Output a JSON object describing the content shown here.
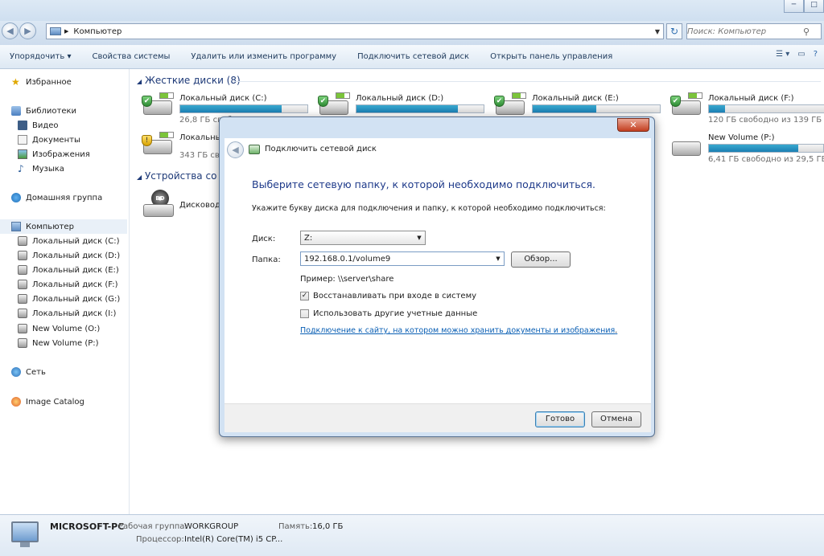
{
  "window": {
    "minimize": "─",
    "maximize": "□"
  },
  "address": {
    "path": "Компьютер",
    "search_placeholder": "Поиск: Компьютер",
    "back": "◀",
    "forward": "▶",
    "refresh": "↻"
  },
  "toolbar": {
    "items": [
      "Упорядочить ▾",
      "Свойства системы",
      "Удалить или изменить программу",
      "Подключить сетевой диск",
      "Открыть панель управления"
    ]
  },
  "sidebar": {
    "favorites": "Избранное",
    "libraries": "Библиотеки",
    "lib_items": [
      "Видео",
      "Документы",
      "Изображения",
      "Музыка"
    ],
    "homegroup": "Домашняя группа",
    "computer": "Компьютер",
    "drives": [
      "Локальный диск (C:)",
      "Локальный диск (D:)",
      "Локальный диск (E:)",
      "Локальный диск (F:)",
      "Локальный диск (G:)",
      "Локальный диск (I:)",
      "New Volume (O:)",
      "New Volume (P:)"
    ],
    "network": "Сеть",
    "image_catalog": "Image Catalog"
  },
  "content": {
    "hdd_header": "Жесткие диски (8)",
    "devices_header": "Устройства со с",
    "disks": [
      {
        "name": "Локальный диск (C:)",
        "free": "26,8 ГБ своб",
        "fill": 0.8
      },
      {
        "name": "Локальный диск (D:)",
        "free": "",
        "fill": 0.8
      },
      {
        "name": "Локальный диск (E:)",
        "free": "",
        "fill": 0.5
      },
      {
        "name": "Локальный диск (F:)",
        "free": "120 ГБ свободно из 139 ГБ",
        "fill": 0.14
      },
      {
        "name": "Локальный",
        "free": "343 ГБ своб",
        "fill": 0.0
      },
      {
        "name": "New Volume (P:)",
        "free": "6,41 ГБ свободно из 29,5 ГБ",
        "fill": 0.78
      }
    ],
    "bd_drive": "Дисковод"
  },
  "status": {
    "pc_name": "MICROSOFT-PC",
    "workgroup_label": "Рабочая группа:",
    "workgroup": "WORKGROUP",
    "memory_label": "Память:",
    "memory": "16,0 ГБ",
    "cpu_label": "Процессор:",
    "cpu": "Intel(R) Core(TM) i5 CP..."
  },
  "dialog": {
    "close": "✕",
    "title": "Подключить сетевой диск",
    "heading": "Выберите сетевую папку, к которой необходимо подключиться.",
    "instruction": "Укажите букву диска для подключения и папку, к которой необходимо подключиться:",
    "drive_label": "Диск:",
    "drive_value": "Z:",
    "folder_label": "Папка:",
    "folder_value": "192.168.0.1/volume9",
    "browse": "Обзор...",
    "example": "Пример: \\\\server\\share",
    "reconnect": "Восстанавливать при входе в систему",
    "reconnect_checked": true,
    "other_creds": "Использовать другие учетные данные",
    "other_creds_checked": false,
    "link": "Подключение к сайту, на котором можно хранить документы и изображения",
    "link_suffix": ".",
    "ok": "Готово",
    "cancel": "Отмена"
  }
}
